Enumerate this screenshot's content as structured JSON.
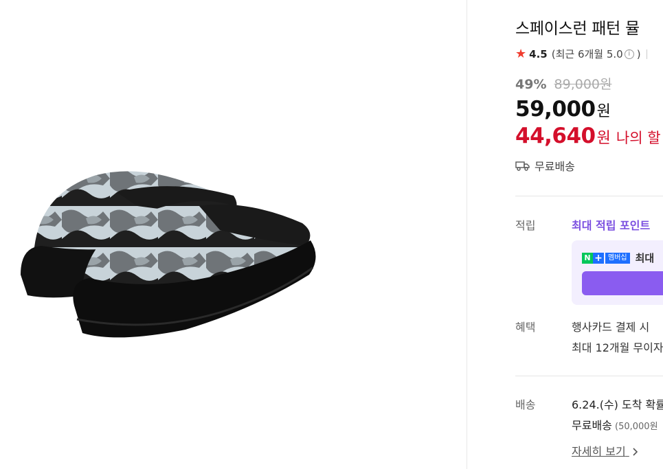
{
  "product": {
    "title": "스페이스런 패턴 뮬 ",
    "rating": "4.5",
    "rating_recent": "(최근 6개월 5.0",
    "rating_close": ")",
    "discount_pct": "49%",
    "original_price": "89,000원",
    "price": "59,000",
    "price_unit": "원",
    "my_price": "44,640",
    "my_price_unit": "원",
    "my_price_label": "나의 할",
    "shipping_summary": "무료배송"
  },
  "points": {
    "label": "적립",
    "max_text": "최대 적립 포인트 ",
    "badge_n": "N",
    "badge_plus": "+",
    "badge_membership": "멤버십",
    "badge_max": "최대"
  },
  "benefit": {
    "label": "혜택",
    "line1": "행사카드 결제 시 ",
    "line2": "최대 12개월 무이자"
  },
  "delivery": {
    "label": "배송",
    "line1": "6.24.(수) 도착 확률",
    "line2": "무료배송",
    "line2_note": " (50,000원",
    "detail_link": "자세히 보기"
  },
  "colors": {
    "accent_red": "#d40f2b",
    "point_purple": "#7b4fe0",
    "star": "#f03c2e"
  },
  "icons": [
    "star-icon",
    "info-icon",
    "truck-icon",
    "chevron-right-icon"
  ]
}
